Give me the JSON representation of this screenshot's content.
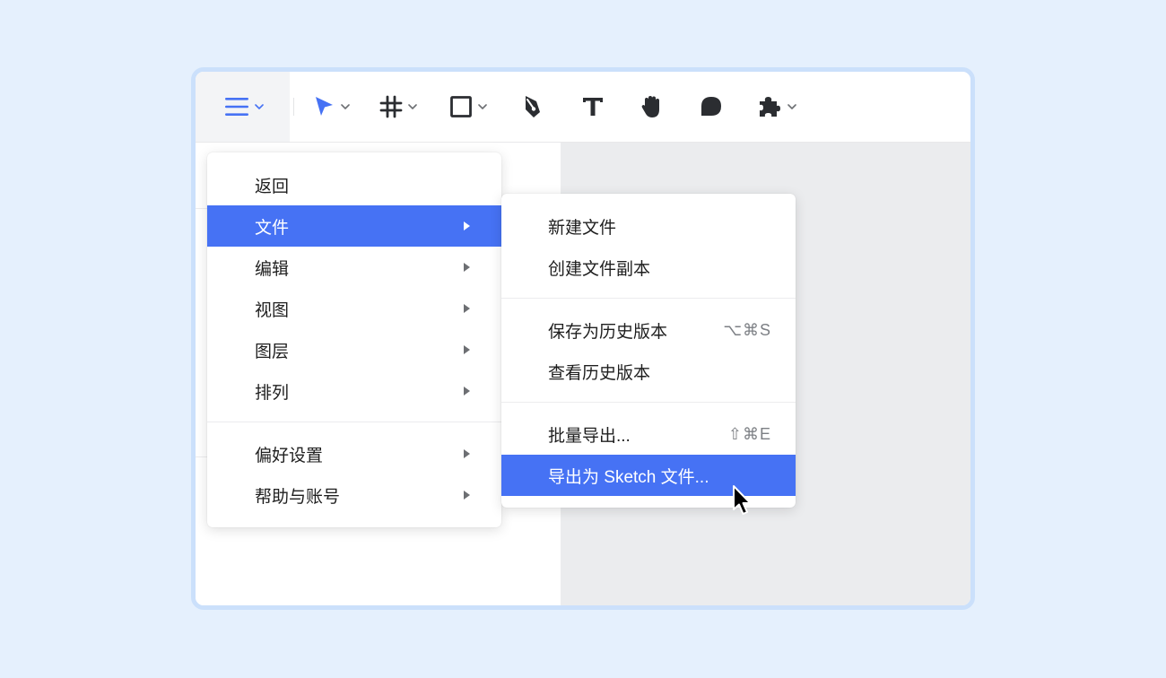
{
  "toolbar": {
    "tools": [
      {
        "name": "menu",
        "icon": "hamburger-icon",
        "active": true,
        "dropdown": true
      },
      {
        "name": "move",
        "icon": "pointer-arrow-icon",
        "dropdown": true
      },
      {
        "name": "frame",
        "icon": "frame-hash-icon",
        "dropdown": true
      },
      {
        "name": "rectangle",
        "icon": "rectangle-icon",
        "dropdown": true
      },
      {
        "name": "pen",
        "icon": "pen-nib-icon",
        "dropdown": false
      },
      {
        "name": "text",
        "icon": "text-t-icon",
        "dropdown": false
      },
      {
        "name": "hand",
        "icon": "hand-icon",
        "dropdown": false
      },
      {
        "name": "comment",
        "icon": "comment-bubble-icon",
        "dropdown": false
      },
      {
        "name": "plugins",
        "icon": "puzzle-icon",
        "dropdown": true
      }
    ]
  },
  "main_menu": {
    "items": [
      {
        "label": "返回",
        "submenu": false
      },
      {
        "label": "文件",
        "submenu": true,
        "active": true
      },
      {
        "label": "编辑",
        "submenu": true
      },
      {
        "label": "视图",
        "submenu": true
      },
      {
        "label": "图层",
        "submenu": true
      },
      {
        "label": "排列",
        "submenu": true
      }
    ],
    "items2": [
      {
        "label": "偏好设置",
        "submenu": true
      },
      {
        "label": "帮助与账号",
        "submenu": true
      }
    ]
  },
  "file_menu": {
    "group1": [
      {
        "label": "新建文件"
      },
      {
        "label": "创建文件副本"
      }
    ],
    "group2": [
      {
        "label": "保存为历史版本",
        "shortcut": "⌥⌘S"
      },
      {
        "label": "查看历史版本"
      }
    ],
    "group3": [
      {
        "label": "批量导出...",
        "shortcut": "⇧⌘E"
      },
      {
        "label": "导出为 Sketch 文件...",
        "active": true
      }
    ]
  },
  "colors": {
    "accent": "#4672f4",
    "background": "#e5f0fd",
    "window_border": "#cbe0fb",
    "canvas": "#ebecee",
    "icon": "#2b2d31"
  }
}
